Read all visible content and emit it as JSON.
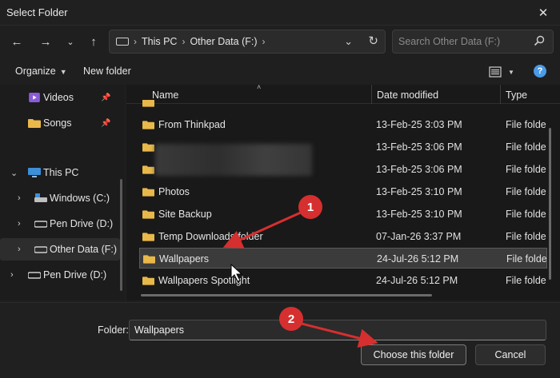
{
  "window": {
    "title": "Select Folder"
  },
  "address": {
    "crumbs": [
      "This PC",
      "Other Data (F:)"
    ]
  },
  "search": {
    "placeholder": "Search Other Data (F:)"
  },
  "toolbar": {
    "organize": "Organize",
    "new_folder": "New folder",
    "help": "?"
  },
  "sidebar": {
    "items": [
      {
        "label": "Videos"
      },
      {
        "label": "Songs"
      },
      {
        "label": "This PC"
      },
      {
        "label": "Windows (C:)"
      },
      {
        "label": "Pen Drive (D:)"
      },
      {
        "label": "Other Data (F:)"
      },
      {
        "label": "Pen Drive (D:)"
      }
    ]
  },
  "columns": {
    "name": "Name",
    "date": "Date modified",
    "type": "Type"
  },
  "rows": [
    {
      "name": "From Thinkpad",
      "date": "13-Feb-25 3:03 PM",
      "type": "File folde"
    },
    {
      "name": "",
      "date": "13-Feb-25 3:06 PM",
      "type": "File folde"
    },
    {
      "name": "",
      "date": "13-Feb-25 3:06 PM",
      "type": "File folde"
    },
    {
      "name": "Photos",
      "date": "13-Feb-25 3:10 PM",
      "type": "File folde"
    },
    {
      "name": "Site Backup",
      "date": "13-Feb-25 3:10 PM",
      "type": "File folde"
    },
    {
      "name": "Temp Downloads folder",
      "date": "07-Jan-26 3:37 PM",
      "type": "File folde"
    },
    {
      "name": "Wallpapers",
      "date": "24-Jul-26 5:12 PM",
      "type": "File folde"
    },
    {
      "name": "Wallpapers Spotlight",
      "date": "24-Jul-26 5:12 PM",
      "type": "File folde"
    }
  ],
  "footer": {
    "folder_label": "Folder:",
    "folder_value": "Wallpapers",
    "choose": "Choose this folder",
    "cancel": "Cancel"
  },
  "callouts": {
    "one": "1",
    "two": "2"
  },
  "colors": {
    "callout": "#d62f2f",
    "folder": "#e8b84a",
    "accent": "#4a9be8"
  }
}
